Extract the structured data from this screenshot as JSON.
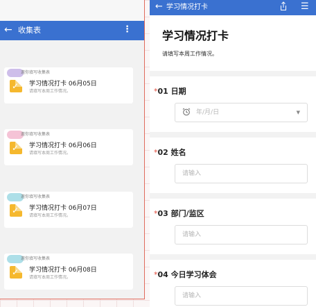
{
  "left": {
    "header": {
      "title": "收集表",
      "back_icon": "back-arrow-icon",
      "more_icon": "more-vertical-icon"
    },
    "messages": [
      {
        "invite": "邀你填写收集表",
        "title": "学习情况打卡 06月05日",
        "subtitle": "请填写本周工作情况。",
        "avatar_color": "#c6b3e6"
      },
      {
        "invite": "邀你填写收集表",
        "title": "学习情况打卡 06月06日",
        "subtitle": "请填写本周工作情况。",
        "avatar_color": "#f3b9cf"
      },
      {
        "invite": "邀你填写收集表",
        "title": "学习情况打卡 06月07日",
        "subtitle": "请填写本周工作情况。",
        "avatar_color": "#9fd9e4"
      },
      {
        "invite": "邀你填写收集表",
        "title": "学习情况打卡 06月08日",
        "subtitle": "请填写本周工作情况。",
        "avatar_color": "#9fd9e4"
      }
    ]
  },
  "right": {
    "header": {
      "title": "学习情况打卡",
      "back_icon": "back-arrow-icon",
      "share_icon": "share-icon",
      "menu_icon": "menu-icon"
    },
    "form": {
      "title": "学习情况打卡",
      "description": "请填写本周工作情况。"
    },
    "questions": [
      {
        "star": "*",
        "label": "01 日期",
        "placeholder": "年/月/日",
        "type": "date"
      },
      {
        "star": "*",
        "label": "02 姓名",
        "placeholder": "请输入",
        "type": "text"
      },
      {
        "star": "*",
        "label": "03 部门/监区",
        "placeholder": "请输入",
        "type": "text"
      },
      {
        "star": "*",
        "label": "04 今日学习体会",
        "placeholder": "请输入",
        "type": "text"
      }
    ]
  },
  "colors": {
    "accent": "#3a71d0",
    "required": "#e14b3c",
    "doc_icon": "#f5b82e",
    "outline": "#e06a5b"
  }
}
